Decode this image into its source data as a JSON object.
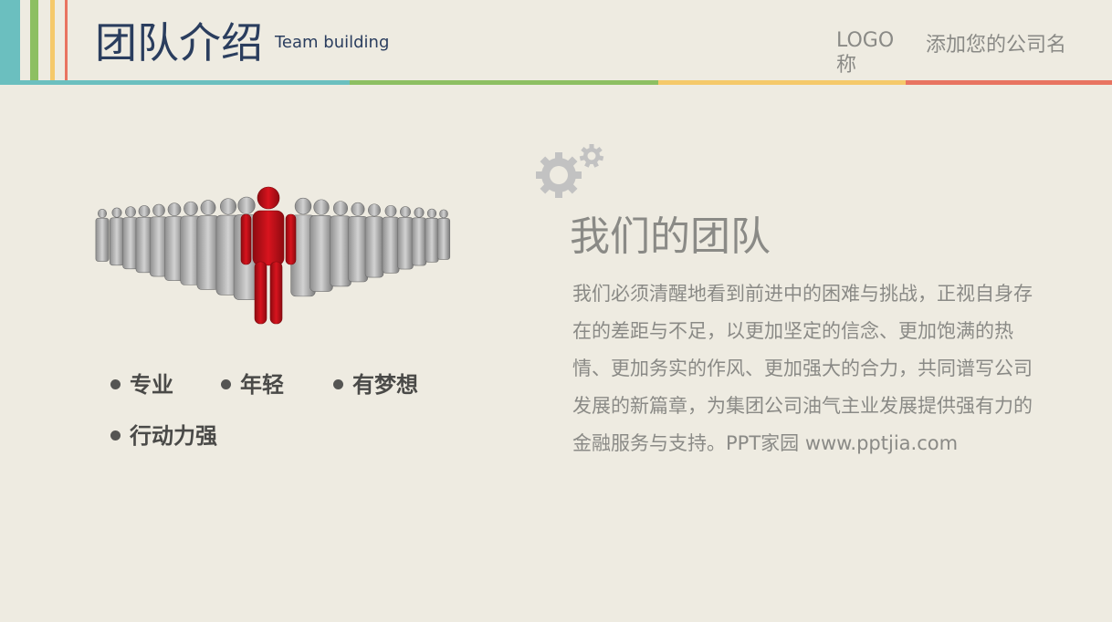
{
  "header": {
    "title": "团队介绍",
    "subtitle": "Team building",
    "logo": "LOGO称",
    "company": "添加您的公司名"
  },
  "colors": {
    "teal": "#6bbfbf",
    "green": "#8dbf62",
    "yellow": "#f5c96a",
    "red": "#e87461",
    "figure_red": "#c8101a",
    "figure_gray": "#b4b4b4",
    "gear_gray": "#c2c2c2"
  },
  "left": {
    "icons": [
      "crowd-of-people-illustration",
      "red-leader-figure"
    ],
    "bullets": [
      "专业",
      "年轻",
      "有梦想",
      "行动力强"
    ]
  },
  "right": {
    "icon": "gears-icon",
    "heading": "我们的团队",
    "body": "我们必须清醒地看到前进中的困难与挑战，正视自身存在的差距与不足，以更加坚定的信念、更加饱满的热情、更加务实的作风、更加强大的合力，共同谱写公司发展的新篇章，为集团公司油气主业发展提供强有力的金融服务与支持。PPT家园 www.pptjia.com"
  }
}
